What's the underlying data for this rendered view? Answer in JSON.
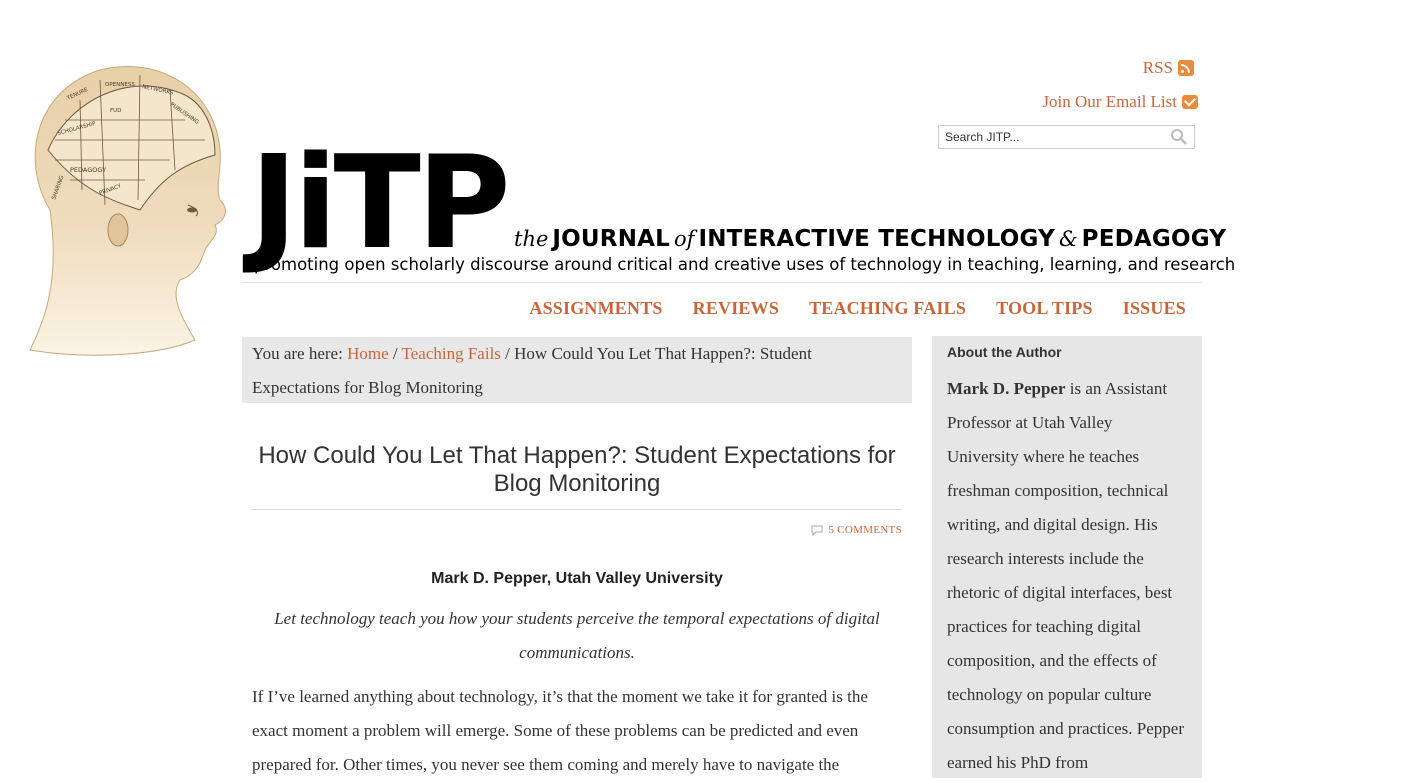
{
  "header": {
    "rss_label": "RSS",
    "email_label": "Join Our Email List",
    "search_placeholder": "Search JITP...",
    "logo_text": "JiTP",
    "logo_the": "the",
    "logo_journal": "JOURNAL",
    "logo_of": "of",
    "logo_it": "INTERACTIVE TECHNOLOGY",
    "logo_amp": "&",
    "logo_ped": "PEDAGOGY",
    "tagline": "promoting open scholarly discourse around critical and creative uses of technology in teaching, learning, and research",
    "head_labels": [
      "TENURE",
      "OPENNESS",
      "NETWORKS",
      "PUBLISHING",
      "SCHOLARSHIP",
      "FUD",
      "PEDAGOGY",
      "PRIVACY",
      "SHARING"
    ]
  },
  "nav": {
    "items": [
      "ASSIGNMENTS",
      "REVIEWS",
      "TEACHING FAILS",
      "TOOL TIPS",
      "ISSUES"
    ]
  },
  "breadcrumb": {
    "prefix": "You are here:",
    "home": "Home",
    "sep1": "/",
    "section": "Teaching Fails",
    "sep2": "/",
    "current": "How Could You Let That Happen?: Student Expectations for Blog Monitoring"
  },
  "article": {
    "title": "How Could You Let That Happen?: Student Expectations for Blog Monitoring",
    "comments": "5 COMMENTS",
    "author": "Mark D. Pepper, Utah Valley University",
    "lede": "Let technology teach you how your students perceive the temporal expectations of digital communications.",
    "body": "If I’ve learned anything about technology, it’s that the moment we take it for granted is the exact moment a problem will emerge. Some of these problems can be predicted and even prepared for. Other times, you never see them coming and merely have to navigate the"
  },
  "sidebar": {
    "heading": "About the Author",
    "author_name": "Mark D. Pepper",
    "bio": " is an Assistant Professor at Utah Valley University where he teaches freshman composition, technical writing, and digital design. His research interests include the rhetoric of digital interfaces, best practices for teaching digital composition, and the effects of technology on popular culture consumption and practices. Pepper earned his PhD from"
  },
  "colors": {
    "accent": "#c8663a",
    "icon_orange": "#e98b3b",
    "panel_gray": "#e8e8e8"
  }
}
